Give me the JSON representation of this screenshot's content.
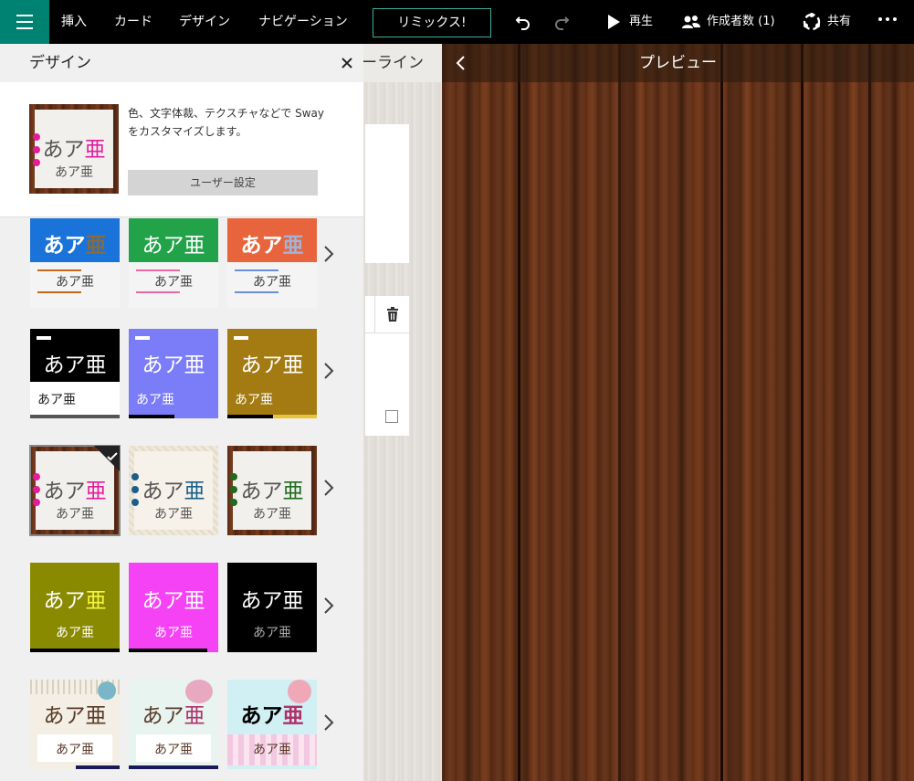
{
  "toolbar": {
    "nav": [
      "挿入",
      "カード",
      "デザイン",
      "ナビゲーション"
    ],
    "remix_label": "リミックス!",
    "play_label": "再生",
    "authors_label": "作成者数 (1)",
    "share_label": "共有"
  },
  "storyline": {
    "title": "ーライン"
  },
  "preview": {
    "title": "プレビュー"
  },
  "design_panel": {
    "title": "デザイン",
    "description": "色、文字体裁、テクスチャなどで Sway をカスタマイズします。",
    "customize_button": "ユーザー設定",
    "sample_big": [
      "あア",
      "亜"
    ],
    "sample_small": "あア亜",
    "selected_theme": "row3-col1"
  },
  "colors": {
    "accent": "#008272",
    "blue": "#1a73d9",
    "green": "#22a34a",
    "orange": "#e8643c",
    "violet": "#7b7cf7",
    "olive": "#a37b12",
    "olive2": "#8a8a00",
    "magenta": "#f542f5",
    "pink_accent": "#e31c9e"
  }
}
